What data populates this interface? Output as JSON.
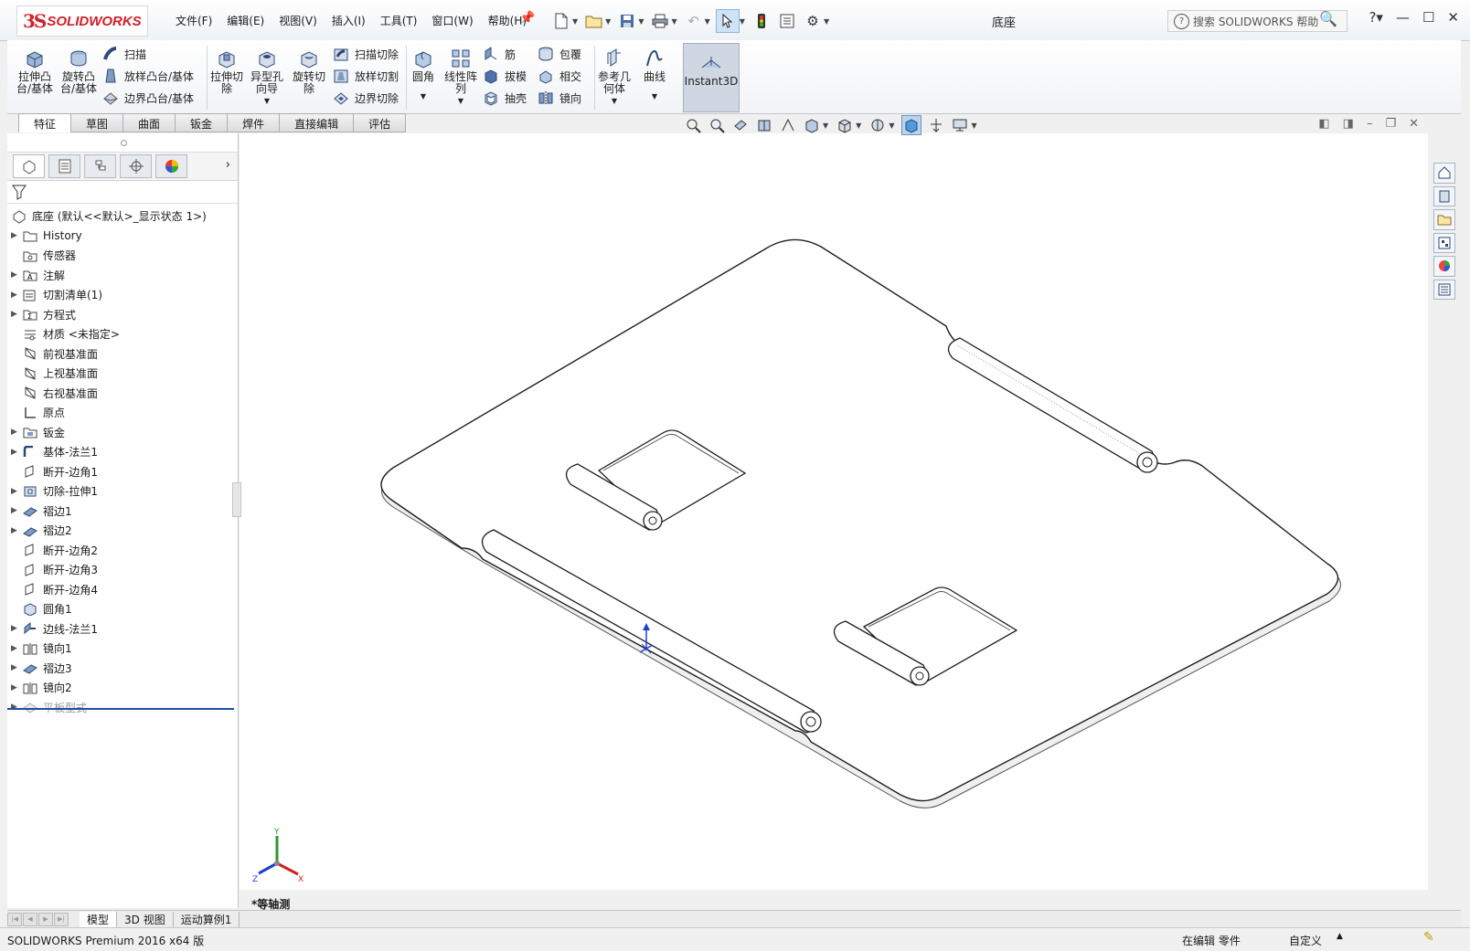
{
  "app": {
    "logo_ds": "3S",
    "logo_name": "SOLIDWORKS",
    "doc_title": "底座"
  },
  "menu": [
    "文件(F)",
    "编辑(E)",
    "视图(V)",
    "插入(I)",
    "工具(T)",
    "窗口(W)",
    "帮助(H)"
  ],
  "search": {
    "placeholder": "搜索 SOLIDWORKS 帮助"
  },
  "toolbar": {
    "extrude_boss": "拉伸凸\n台/基体",
    "revolve_boss": "旋转凸\n台/基体",
    "sweep": "扫描",
    "loft_boss": "放样凸台/基体",
    "boundary_boss": "边界凸台/基体",
    "extrude_cut": "拉伸切\n除",
    "hole_wizard": "异型孔\n向导",
    "revolve_cut": "旋转切\n除",
    "sweep_cut": "扫描切除",
    "loft_cut": "放样切割",
    "boundary_cut": "边界切除",
    "fillet": "圆角",
    "linear_pattern": "线性阵\n列",
    "rib": "筋",
    "draft": "拔模",
    "shell": "抽壳",
    "wrap": "包覆",
    "intersect": "相交",
    "mirror": "镜向",
    "ref_geometry": "参考几\n何体",
    "curves": "曲线",
    "instant3d": "Instant3D"
  },
  "tabs": [
    "特征",
    "草图",
    "曲面",
    "钣金",
    "焊件",
    "直接编辑",
    "评估"
  ],
  "tree": {
    "root": "底座 (默认<<默认>_显示状态 1>)",
    "items": [
      {
        "label": "History",
        "expandable": true
      },
      {
        "label": "传感器",
        "expandable": false
      },
      {
        "label": "注解",
        "expandable": true
      },
      {
        "label": "切割清单(1)",
        "expandable": true
      },
      {
        "label": "方程式",
        "expandable": true
      },
      {
        "label": "材质 <未指定>",
        "expandable": false
      },
      {
        "label": "前视基准面",
        "expandable": false
      },
      {
        "label": "上视基准面",
        "expandable": false
      },
      {
        "label": "右视基准面",
        "expandable": false
      },
      {
        "label": "原点",
        "expandable": false
      },
      {
        "label": "钣金",
        "expandable": true
      },
      {
        "label": "基体-法兰1",
        "expandable": true
      },
      {
        "label": "断开-边角1",
        "expandable": false
      },
      {
        "label": "切除-拉伸1",
        "expandable": true
      },
      {
        "label": "褶边1",
        "expandable": true
      },
      {
        "label": "褶边2",
        "expandable": true
      },
      {
        "label": "断开-边角2",
        "expandable": false
      },
      {
        "label": "断开-边角3",
        "expandable": false
      },
      {
        "label": "断开-边角4",
        "expandable": false
      },
      {
        "label": "圆角1",
        "expandable": false
      },
      {
        "label": "边线-法兰1",
        "expandable": true
      },
      {
        "label": "镜向1",
        "expandable": true
      },
      {
        "label": "褶边3",
        "expandable": true
      },
      {
        "label": "镜向2",
        "expandable": true
      },
      {
        "label": "平板型式",
        "expandable": true
      }
    ]
  },
  "view": {
    "orientation_label": "*等轴测",
    "triad": {
      "x": "X",
      "y": "Y",
      "z": "Z"
    }
  },
  "bottom_tabs": [
    "模型",
    "3D 视图",
    "运动算例1"
  ],
  "status": {
    "left": "SOLIDWORKS Premium 2016 x64 版",
    "mode": "在编辑 零件",
    "units": "自定义"
  }
}
